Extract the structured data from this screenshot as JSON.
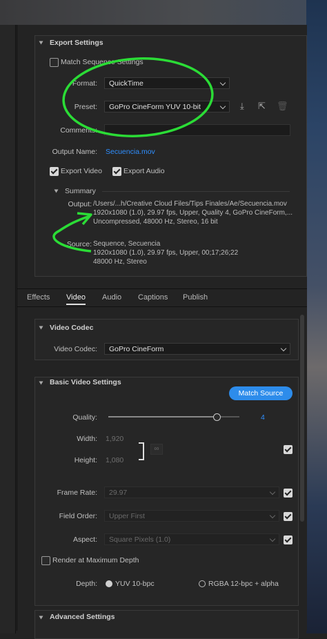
{
  "export_settings": {
    "header": "Export Settings",
    "match_sequence_label": "Match Sequence Settings",
    "format_label": "Format:",
    "format_value": "QuickTime",
    "preset_label": "Preset:",
    "preset_value": "GoPro CineForm YUV 10-bit",
    "comments_label": "Comments:",
    "output_name_label": "Output Name:",
    "output_name_value": "Secuencia.mov",
    "export_video_label": "Export Video",
    "export_audio_label": "Export Audio"
  },
  "summary": {
    "header": "Summary",
    "output_label": "Output:",
    "output_lines": [
      "/Users/...h/Creative Cloud Files/Tips Finales/Ae/Secuencia.mov",
      "1920x1080 (1.0), 29.97 fps, Upper, Quality 4, GoPro CineForm,...",
      "Uncompressed, 48000 Hz, Stereo, 16 bit"
    ],
    "source_label": "Source:",
    "source_lines": [
      "Sequence, Secuencia",
      "1920x1080 (1.0), 29.97 fps, Upper, 00;17;26;22",
      "48000 Hz, Stereo"
    ]
  },
  "tabs": [
    "Effects",
    "Video",
    "Audio",
    "Captions",
    "Publish"
  ],
  "video_codec": {
    "header": "Video Codec",
    "label": "Video Codec:",
    "value": "GoPro CineForm"
  },
  "basic_video": {
    "header": "Basic Video Settings",
    "match_source": "Match Source",
    "quality_label": "Quality:",
    "quality_value": "4",
    "width_label": "Width:",
    "width_value": "1,920",
    "height_label": "Height:",
    "height_value": "1,080",
    "frame_rate_label": "Frame Rate:",
    "frame_rate_value": "29.97",
    "field_order_label": "Field Order:",
    "field_order_value": "Upper First",
    "aspect_label": "Aspect:",
    "aspect_value": "Square Pixels (1.0)",
    "render_max_label": "Render at Maximum Depth",
    "depth_label": "Depth:",
    "depth_opt1": "YUV 10-bpc",
    "depth_opt2": "RGBA 12-bpc + alpha"
  },
  "advanced": {
    "header": "Advanced Settings"
  },
  "colors": {
    "accent": "#2d8ceb",
    "annotation": "#2bdc36"
  }
}
